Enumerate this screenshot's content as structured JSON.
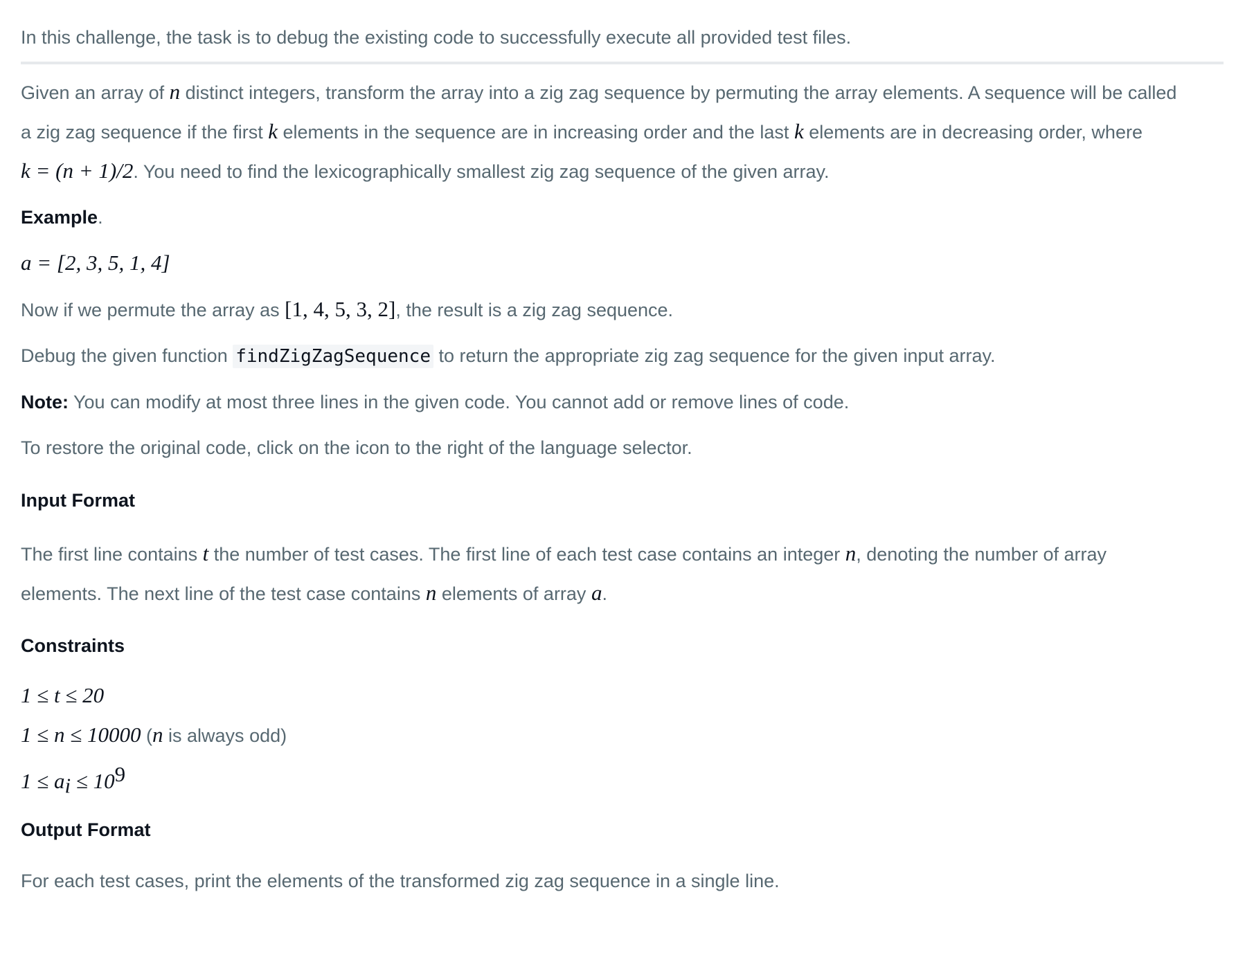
{
  "intro": "In this challenge, the task is to debug the existing code to successfully execute all provided test files.",
  "description": {
    "l1_a": "Given an array of ",
    "l1_n": "n",
    "l1_b": " distinct integers, transform the array into a zig zag sequence by permuting the array elements. A sequence will be called",
    "l2_a": "a zig zag sequence if the first ",
    "l2_k1": "k",
    "l2_b": " elements in the sequence are in increasing order and the last ",
    "l2_k2": "k",
    "l2_c": " elements are in decreasing order, where",
    "l3_formula": "k = (n + 1)/2",
    "l3_b": ". You need to find the lexicographically smallest zig zag sequence of the given array."
  },
  "example": {
    "heading": "Example",
    "dot": ".",
    "array": "a = [2, 3, 5, 1, 4]",
    "permute_a": "Now if we permute the array as ",
    "permute_math": "[1, 4, 5, 3, 2]",
    "permute_b": ", the result is a zig zag sequence."
  },
  "debug": {
    "a": "Debug the given function ",
    "code": "findZigZagSequence",
    "b": " to return the appropriate zig zag sequence for the given input array."
  },
  "note": {
    "label": "Note:",
    "text": " You can modify at most three lines in the given code. You cannot add or remove lines of code."
  },
  "restore": "To restore the original code, click on the icon to the right of the language selector.",
  "input_format": {
    "heading": "Input Format",
    "l1_a": "The first line contains ",
    "l1_t": "t",
    "l1_b": " the number of test cases. The first line of each test case contains an integer ",
    "l1_n": "n",
    "l1_c": ", denoting the number of array",
    "l2_a": "elements. The next line of the test case contains ",
    "l2_n": "n",
    "l2_b": " elements of array ",
    "l2_a_var": "a",
    "l2_end": "."
  },
  "constraints": {
    "heading": "Constraints",
    "c1": "1 ≤ t ≤ 20",
    "c2_math": "1 ≤ n ≤ 10000",
    "c2_open": " (",
    "c2_n": "n",
    "c2_text": " is always odd)",
    "c3_pre": "1 ≤ a",
    "c3_sub": "i",
    "c3_mid": " ≤ 10",
    "c3_sup": "9"
  },
  "output_format": {
    "heading": "Output Format",
    "text": "For each test cases, print the elements of the transformed zig zag sequence in a single line."
  }
}
